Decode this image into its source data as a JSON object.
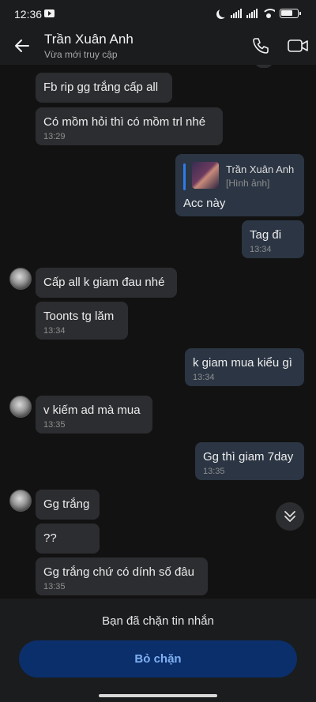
{
  "status_bar": {
    "time": "12:36"
  },
  "header": {
    "name": "Trần Xuân Anh",
    "status": "Vừa mới truy cập"
  },
  "messages": [
    {
      "text": "Fb rip gg trắng cấp all",
      "time": ""
    },
    {
      "text": "Có mồm hỏi thì có mồm trl nhé",
      "time": "13:29"
    },
    {
      "reply_to_name": "Trần Xuân Anh",
      "reply_to_type": "[Hình ảnh]",
      "text": "Acc này",
      "time": ""
    },
    {
      "text": "Tag đi",
      "time": "13:34"
    },
    {
      "text": "Cấp all k giam đau nhé",
      "time": ""
    },
    {
      "text": "Toonts tg lăm",
      "time": "13:34"
    },
    {
      "text": "k giam mua kiểu gì",
      "time": "13:34"
    },
    {
      "text": "v kiếm ad mà mua",
      "time": "13:35"
    },
    {
      "text": "Gg thì giam 7day",
      "time": "13:35"
    },
    {
      "text": "Gg trắng",
      "time": ""
    },
    {
      "text": "??",
      "time": ""
    },
    {
      "text": "Gg trắng chứ có dính số đâu",
      "time": "13:35"
    }
  ],
  "footer": {
    "blocked_notice": "Bạn đã chặn tin nhắn",
    "unblock_label": "Bỏ chặn"
  },
  "colors": {
    "accent": "#2f7be8",
    "outgoing_bubble": "#2b3543",
    "incoming_bubble": "#2c2d30",
    "unblock_bg": "#0b2f6b"
  },
  "icons": [
    "back-arrow-icon",
    "phone-icon",
    "video-camera-icon",
    "chevron-double-down-icon",
    "youtube-icon",
    "moon-icon",
    "signal-icon",
    "wifi-icon",
    "battery-icon"
  ]
}
